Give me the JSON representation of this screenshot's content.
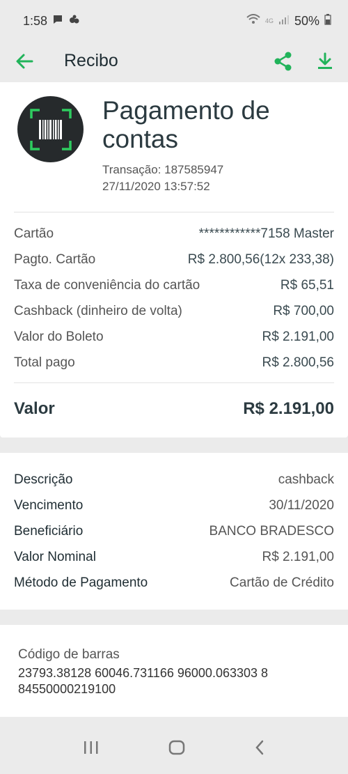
{
  "status": {
    "time": "1:58",
    "network": "4G",
    "battery": "50%"
  },
  "appbar": {
    "title": "Recibo"
  },
  "header": {
    "title": "Pagamento de contas",
    "transaction": "Transação: 187585947",
    "datetime": "27/11/2020 13:57:52"
  },
  "details": [
    {
      "label": "Cartão",
      "value": "************7158 Master"
    },
    {
      "label": "Pagto. Cartão",
      "value": "R$ 2.800,56(12x 233,38)"
    },
    {
      "label": "Taxa de conveniência do cartão",
      "value": "R$ 65,51"
    },
    {
      "label": "Cashback (dinheiro de volta)",
      "value": "R$ 700,00"
    },
    {
      "label": "Valor do Boleto",
      "value": "R$ 2.191,00"
    },
    {
      "label": "Total pago",
      "value": "R$ 2.800,56"
    }
  ],
  "valor": {
    "label": "Valor",
    "value": "R$ 2.191,00"
  },
  "info": [
    {
      "label": "Descrição",
      "value": "cashback"
    },
    {
      "label": "Vencimento",
      "value": "30/11/2020"
    },
    {
      "label": "Beneficiário",
      "value": "BANCO BRADESCO"
    },
    {
      "label": "Valor Nominal",
      "value": "R$ 2.191,00"
    },
    {
      "label": "Método de Pagamento",
      "value": "Cartão de Crédito"
    }
  ],
  "barcode": {
    "label": "Código de barras",
    "value": "23793.38128 60046.731166 96000.063303 8 84550000219100"
  },
  "colors": {
    "accent": "#21b35a",
    "corner": "#2ecc5f"
  }
}
